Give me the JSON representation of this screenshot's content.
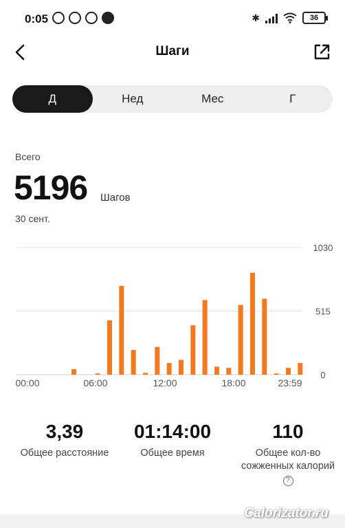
{
  "status_bar": {
    "time": "0:05",
    "icons": [
      "alarm-icon",
      "yandex-icon",
      "pet-icon",
      "ball-icon"
    ],
    "battery": "36"
  },
  "header": {
    "title": "Шаги"
  },
  "tabs": [
    {
      "label": "Д",
      "active": true
    },
    {
      "label": "Нед",
      "active": false
    },
    {
      "label": "Мес",
      "active": false
    },
    {
      "label": "Г",
      "active": false
    }
  ],
  "summary": {
    "label": "Всего",
    "value": "5196",
    "unit": "Шагов",
    "date": "30 сент."
  },
  "chart_data": {
    "type": "bar",
    "x_ticks": [
      "00:00",
      "06:00",
      "12:00",
      "18:00",
      "23:59"
    ],
    "y_ticks": [
      "1030",
      "515",
      "0"
    ],
    "ylim": [
      0,
      1030
    ],
    "bar_color": "#f47a20",
    "hours": [
      0,
      1,
      2,
      3,
      4,
      5,
      6,
      7,
      8,
      9,
      10,
      11,
      12,
      13,
      14,
      15,
      16,
      17,
      18,
      19,
      20,
      21,
      22,
      23
    ],
    "values": [
      0,
      0,
      0,
      0,
      45,
      0,
      10,
      440,
      720,
      200,
      15,
      225,
      95,
      120,
      400,
      605,
      65,
      55,
      565,
      825,
      615,
      10,
      55,
      95
    ]
  },
  "stats": [
    {
      "value": "3,39",
      "label": "Общее расстояние"
    },
    {
      "value": "01:14:00",
      "label": "Общее время"
    },
    {
      "value": "110",
      "label": "Общее кол-во сожженных калорий"
    }
  ],
  "watermark": "Calorizator.ru"
}
